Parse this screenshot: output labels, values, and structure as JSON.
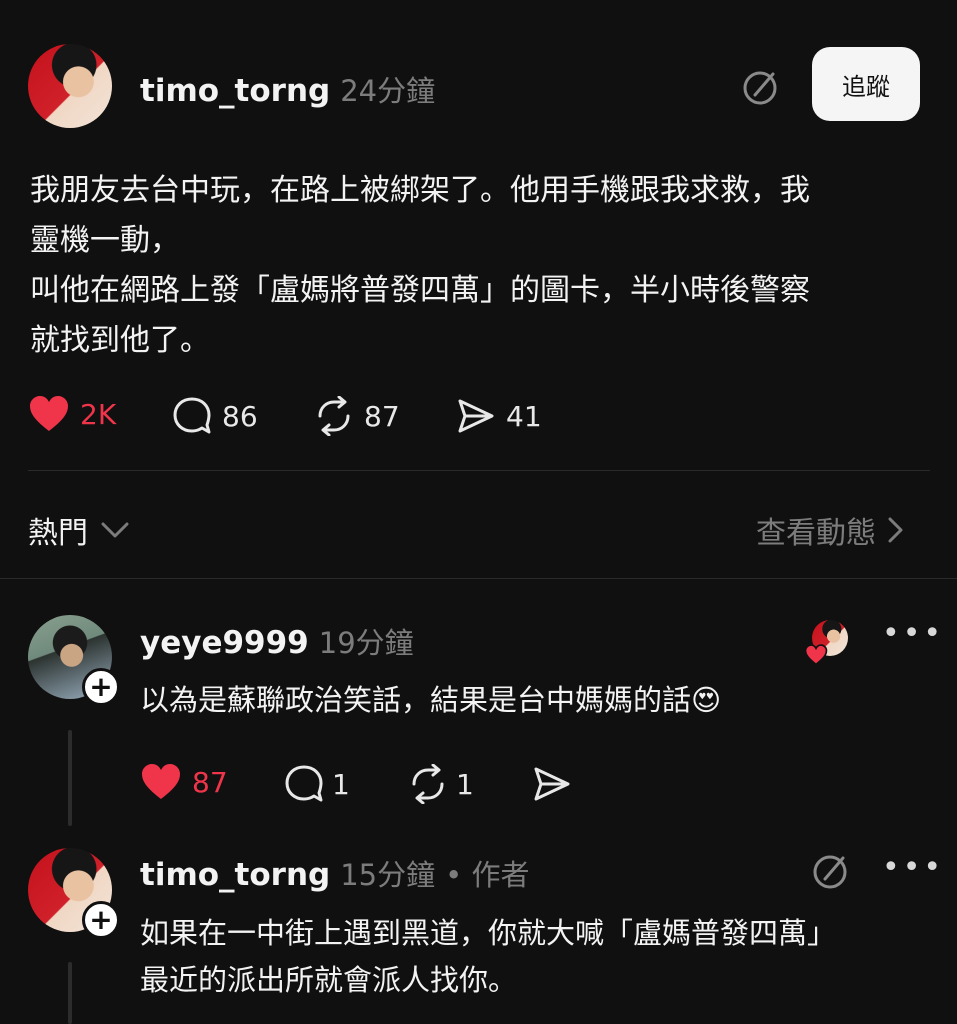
{
  "post": {
    "username": "timo_torng",
    "time": "24分鐘",
    "follow_label": "追蹤",
    "text": "我朋友去台中玩，在路上被綁架了。他用手機跟我求救，我\n靈機一動，\n叫他在網路上發「盧媽將普發四萬」的圖卡，半小時後警察\n就找到他了。",
    "likes": "2K",
    "comments": "86",
    "reposts": "87",
    "shares": "41"
  },
  "sort": {
    "label": "熱門",
    "activity_label": "查看動態"
  },
  "replies": [
    {
      "username": "yeye9999",
      "time": "19分鐘",
      "text": "以為是蘇聯政治笑話，結果是台中媽媽的話😍",
      "likes": "87",
      "comments": "1",
      "reposts": "1"
    },
    {
      "username": "timo_torng",
      "time": "15分鐘",
      "author_tag": "• 作者",
      "text": "如果在一中街上遇到黑道，你就大喊「盧媽普發四萬」\n最近的派出所就會派人找你。"
    }
  ],
  "colors": {
    "background": "#101010",
    "like_red": "#f0344a",
    "muted": "#7c7c7c"
  },
  "icons": {
    "like": "heart-icon",
    "comment": "comment-bubble-icon",
    "repost": "repost-icon",
    "share": "send-icon",
    "edit": "edit-badge-icon",
    "more": "more-icon",
    "chevron_down": "chevron-down-icon",
    "chevron_right": "chevron-right-icon"
  }
}
